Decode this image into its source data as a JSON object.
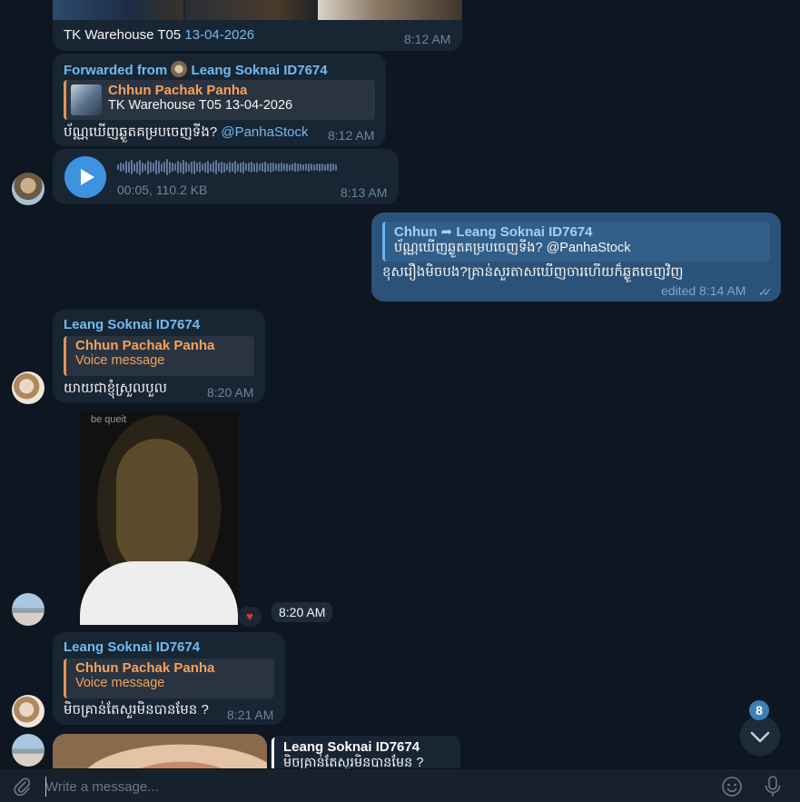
{
  "messages": {
    "m1": {
      "text": "TK Warehouse T05 ",
      "date_link": "13-04-2026",
      "time": "8:12 AM"
    },
    "m2": {
      "forward_prefix": "Forwarded from ",
      "forward_from": "Leang Soknai ID7674",
      "reply_name": "Chhun Pachak Panha",
      "reply_text": "TK Warehouse T05 13-04-2026",
      "text": "ប័ណ្ណឃើញឆ្ងួតគម្របចេញទីង? ",
      "mention": "@PanhaStock",
      "time": "8:12 AM"
    },
    "m3": {
      "meta": "00:05, 110.2 KB",
      "time": "8:13 AM"
    },
    "m4": {
      "reply_name": "Chhun",
      "reply_arrow": "➦",
      "reply_to": "Leang Soknai ID7674",
      "reply_text": "ប័ណ្ណឃើញឆ្ងួតគម្របចេញទីង? @PanhaStock",
      "text": "ខុសរឿងមិចបង?គ្រាន់សួរតាសឃើញចារហើយក៏ឆ្ងួតចេញវិញ",
      "time": "edited 8:14 AM"
    },
    "m5": {
      "sender": "Leang Soknai ID7674",
      "reply_name": "Chhun Pachak Panha",
      "reply_text": "Voice message",
      "text": "យាយជាខ្ញុំស្រួលបួល",
      "time": "8:20 AM"
    },
    "m6": {
      "sticker_caption": "be queit",
      "reaction": "♥",
      "time": "8:20 AM"
    },
    "m7": {
      "sender": "Leang Soknai ID7674",
      "reply_name": "Chhun Pachak Panha",
      "reply_text": "Voice message",
      "text": "មិចគ្រាន់តែសួរមិនបានមែន ?",
      "time": "8:21 AM"
    },
    "m8": {
      "reply_name": "Leang Soknai ID7674",
      "reply_text": "មិចគ្រាន់តែសួរមិនបានមែន ?"
    }
  },
  "compose": {
    "placeholder": "Write a message..."
  },
  "scroll_badge": "8",
  "icons": {
    "attach": "paperclip-icon",
    "emoji": "smile-icon",
    "mic": "microphone-icon",
    "scroll": "chevron-down-icon"
  },
  "colors": {
    "background": "#0e1621",
    "incoming": "#182533",
    "outgoing": "#2b5278",
    "accent": "#71baf0",
    "reply_orange": "#f5a15b"
  }
}
